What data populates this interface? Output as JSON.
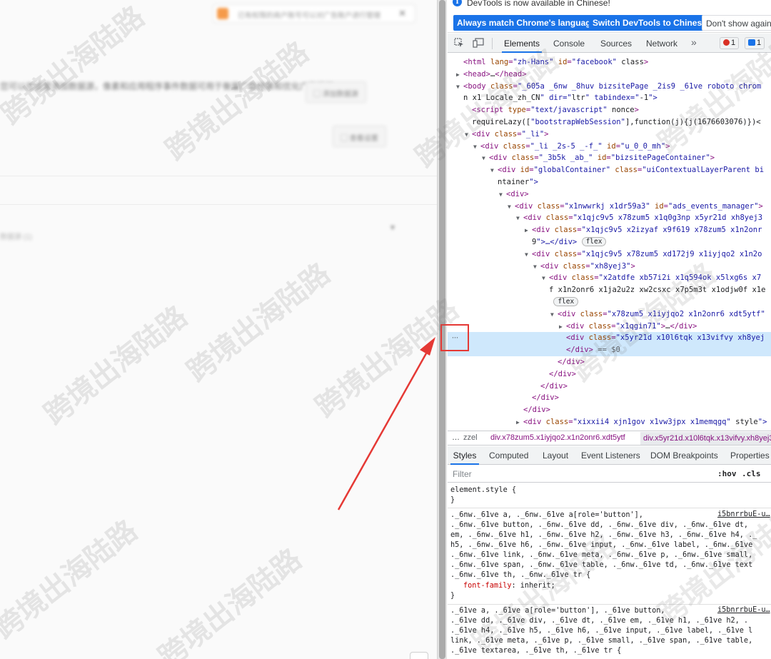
{
  "left_page": {
    "top_notice": "已有权限的商户账号可以对广告账户进行管理",
    "description": "您可以在这里添加数据源，像素和应用程序事件数据可用于衡量广告效果和优化广告投放",
    "button_top": "添加数据源",
    "button_second": "查看设置",
    "small_label": "数据源 (1)"
  },
  "infobar": {
    "message": "DevTools is now available in Chinese!",
    "btn_match": "Always match Chrome's language",
    "btn_switch": "Switch DevTools to Chinese",
    "btn_dismiss": "Don't show again"
  },
  "tabs": {
    "elements": "Elements",
    "console": "Console",
    "sources": "Sources",
    "network": "Network",
    "more": "»",
    "errors": "1",
    "messages": "1"
  },
  "dom": {
    "lines": [
      {
        "indent": 0,
        "tri": "",
        "html": "<html lang=\"zh-Hans\" id=\"facebook\" class>"
      },
      {
        "indent": 0,
        "tri": "▶",
        "html": "<head>…</head>"
      },
      {
        "indent": 0,
        "tri": "▼",
        "html": "<body class=\"_605a _6nw _8huv bizsitePage _2is9 _61ve roboto chrom"
      },
      {
        "indent": 0,
        "tri": "",
        "html": "n x1 Locale_zh_CN\" dir=\"ltr\" tabindex=\"-1\">"
      },
      {
        "indent": 1,
        "tri": "",
        "html": "<script type=\"text/javascript\" nonce>"
      },
      {
        "indent": 1,
        "tri": "",
        "html": "requireLazy([\"bootstrapWebSession\"],function(j){j(1676603076)})<"
      },
      {
        "indent": 1,
        "tri": "▼",
        "html": "<div class=\"_li\">"
      },
      {
        "indent": 2,
        "tri": "▼",
        "html": "<div class=\"_li _2s-5 _-f_\" id=\"u_0_0_mh\">"
      },
      {
        "indent": 3,
        "tri": "▼",
        "html": "<div class=\"_3b5k _ab_\" id=\"bizsitePageContainer\">"
      },
      {
        "indent": 4,
        "tri": "▼",
        "html": "<div id=\"globalContainer\" class=\"uiContextualLayerParent bi"
      },
      {
        "indent": 4,
        "tri": "",
        "html": "ntainer\">"
      },
      {
        "indent": 5,
        "tri": "▼",
        "html": "<div>"
      },
      {
        "indent": 6,
        "tri": "▼",
        "html": "<div class=\"x1nwwrkj x1dr59a3\" id=\"ads_events_manager\">"
      },
      {
        "indent": 7,
        "tri": "▼",
        "html": "<div class=\"x1qjc9v5 x78zum5 x1q0g3np x5yr21d xh8yej3"
      },
      {
        "indent": 8,
        "tri": "▶",
        "html": "<div class=\"x1qjc9v5 x2izyaf x9f619 x78zum5 x1n2onr"
      },
      {
        "indent": 8,
        "tri": "",
        "html": "9\">…</div>",
        "flex": "flex"
      },
      {
        "indent": 8,
        "tri": "▼",
        "html": "<div class=\"x1qjc9v5 x78zum5 xd172j9 x1iyjqo2 x1n2o"
      },
      {
        "indent": 9,
        "tri": "▼",
        "html": "<div class=\"xh8yej3\">"
      },
      {
        "indent": 10,
        "tri": "▼",
        "html": "<div class=\"x2atdfe xb57i2i x1q594ok x5lxg6s x7"
      },
      {
        "indent": 10,
        "tri": "",
        "html": "f x1n2onr6 x1ja2u2z xw2csxc x7p5m3t x1odjw0f x1e"
      },
      {
        "indent": 10,
        "tri": "",
        "html": "",
        "flex": "flex"
      },
      {
        "indent": 11,
        "tri": "▼",
        "html": "<div class=\"x78zum5 x1iyjqo2 x1n2onr6 xdt5ytf\""
      },
      {
        "indent": 12,
        "tri": "▶",
        "html": "<div class=\"x1qgin71\">…</div>"
      },
      {
        "indent": 12,
        "tri": "",
        "html": "<div class=\"x5yr21d x10l6tqk x13vifvy xh8yej",
        "selected": true
      },
      {
        "indent": 12,
        "tri": "",
        "html": "</div> == $0",
        "selected": true
      },
      {
        "indent": 11,
        "tri": "",
        "html": "</div>"
      },
      {
        "indent": 10,
        "tri": "",
        "html": "</div>"
      },
      {
        "indent": 9,
        "tri": "",
        "html": "</div>"
      },
      {
        "indent": 8,
        "tri": "",
        "html": "</div>"
      },
      {
        "indent": 7,
        "tri": "",
        "html": "</div>"
      },
      {
        "indent": 7,
        "tri": "▶",
        "html": "<div class=\"xixxii4 xjn1gov x1vw3jpx x1memqgq\" style\">"
      }
    ]
  },
  "breadcrumb": {
    "dots": "…",
    "item1": "zzel",
    "item2": "div.x78zum5.x1iyjqo2.x1n2onr6.xdt5ytf",
    "item3": "div.x5yr21d.x10l6tqk.x13vifvy.xh8yej3"
  },
  "styles_tabs": {
    "styles": "Styles",
    "computed": "Computed",
    "layout": "Layout",
    "event_listeners": "Event Listeners",
    "dom_breakpoints": "DOM Breakpoints",
    "properties": "Properties"
  },
  "filter": {
    "placeholder": "Filter",
    "hov": ":hov",
    "cls": ".cls"
  },
  "css": {
    "element_style": "element.style {",
    "close": "}",
    "rule1_link": "i5bnrrbuE-u…",
    "rule1_lines": [
      "._6nw._61ve a, ._6nw._61ve a[role='button'],",
      "._6nw._61ve button, ._6nw._61ve dd, ._6nw._61ve div, ._6nw._61ve dt,",
      "em, ._6nw._61ve h1, ._6nw._61ve h2, ._6nw._61ve h3, ._6nw._61ve h4, ._",
      "h5, ._6nw._61ve h6, ._6nw._61ve input, ._6nw._61ve label, ._6nw._61ve",
      "._6nw._61ve link, ._6nw._61ve meta, ._6nw._61ve p, ._6nw._61ve small,",
      "._6nw._61ve span, ._6nw._61ve table, ._6nw._61ve td, ._6nw._61ve text",
      "._6nw._61ve th, ._6nw._61ve tr {"
    ],
    "rule1_prop": "font-family",
    "rule1_value": "inherit;",
    "rule2_link": "i5bnrrbuE-u…",
    "rule2_lines": [
      "._61ve a, ._61ve a[role='button'], ._61ve button,",
      "._61ve dd, ._61ve div, ._61ve dt, ._61ve em, ._61ve h1, ._61ve h2, .",
      "._61ve h4, ._61ve h5, ._61ve h6, ._61ve input, ._61ve label, ._61ve l",
      "link, ._61ve meta, ._61ve p, ._61ve small, ._61ve span, ._61ve table,",
      "._61ve textarea, ._61ve th, ._61ve tr {"
    ]
  },
  "watermark": "跨境出海陆路",
  "colors": {
    "accent": "#1a73e8",
    "highlight": "#e53935",
    "tag": "#881280",
    "attr": "#994500",
    "value": "#1a1aa6"
  }
}
